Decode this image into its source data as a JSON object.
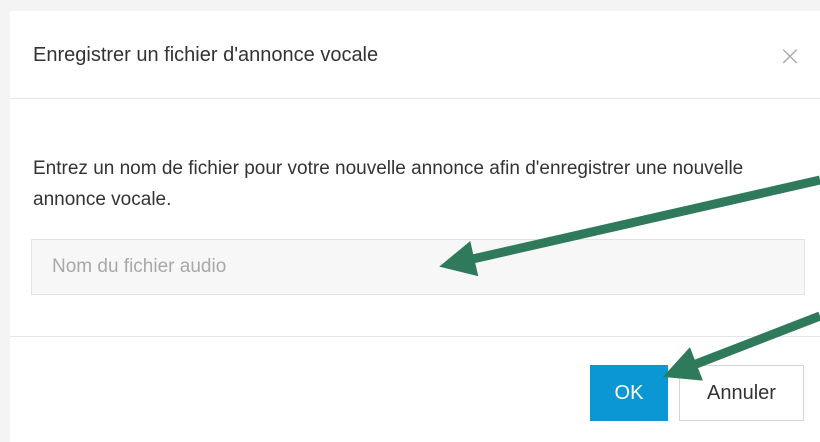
{
  "dialog": {
    "title": "Enregistrer un fichier d'annonce vocale",
    "close_icon": "close-icon",
    "description": "Entrez un nom de fichier pour votre nouvelle annonce afin d'enregistrer une nouvelle annonce vocale.",
    "filename_input": {
      "value": "",
      "placeholder": "Nom du fichier audio"
    },
    "buttons": {
      "ok_label": "OK",
      "cancel_label": "Annuler"
    }
  },
  "colors": {
    "primary_button": "#0b97d4",
    "annotation_arrow": "#2e7a5a",
    "background": "#f4f4f4"
  }
}
